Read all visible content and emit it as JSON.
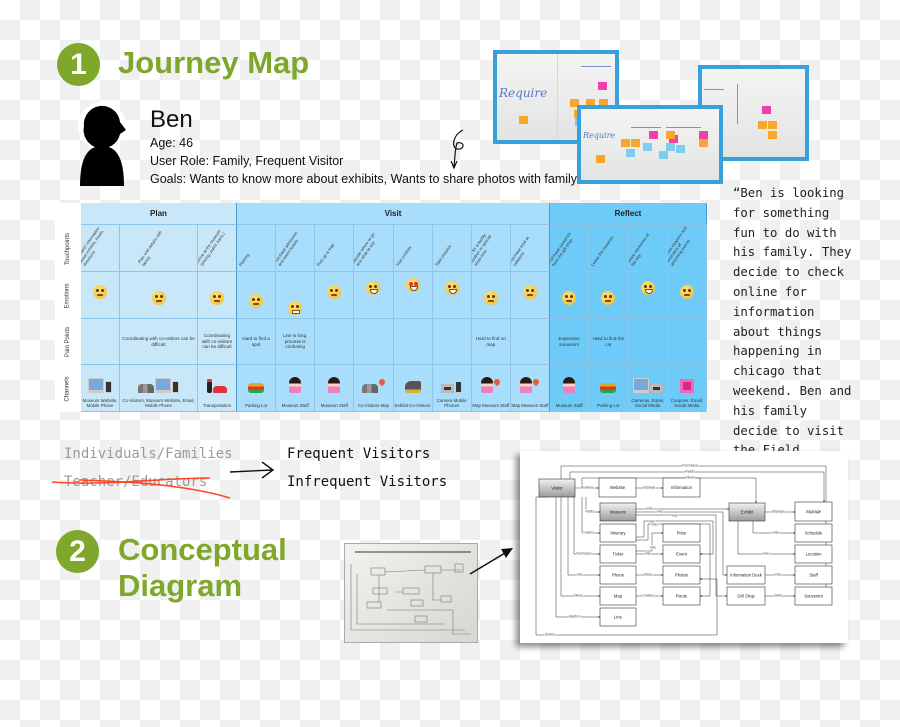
{
  "section1": {
    "number": "1",
    "title": "Journey Map"
  },
  "section2": {
    "number": "2",
    "title_line1": "Conceptual",
    "title_line2": "Diagram"
  },
  "persona": {
    "name": "Ben",
    "age": "Age: 46",
    "role": "User Role: Family, Frequent Visitor",
    "goals": "Goals: Wants to know more about exhibits, Wants to share photos with family"
  },
  "photos": {
    "whiteboard_text": "Require"
  },
  "journey_map": {
    "row_labels": [
      "Touchpoints",
      "Emotions",
      "Pain Points",
      "Channels"
    ],
    "phases": [
      {
        "name": "Plan",
        "columns": 3,
        "color": "#c8e8f9"
      },
      {
        "name": "Visit",
        "columns": 8,
        "color": "#a8defc"
      },
      {
        "name": "Reflect",
        "columns": 4,
        "color": "#6ecbf8"
      }
    ],
    "columns": [
      {
        "touchpoint": "Research information about exhibits, hours, directions",
        "emotion": "relieved",
        "mood": 4,
        "pain": "",
        "channel": "Museum Website, Mobile Phone",
        "icons": [
          "computer-icon",
          "mobile-phone-icon"
        ]
      },
      {
        "touchpoint": "Plan visit details with family",
        "emotion": "flushed",
        "mood": 3,
        "pain": "Coordinating with co-visitors can be difficult",
        "channel": "Co-Visitors, Museum Website, Email, Mobile Phone",
        "icons": [
          "people-icon",
          "computer-icon",
          "mobile-phone-icon"
        ]
      },
      {
        "touchpoint": "Arrive at the museum (driving, public trans.)",
        "emotion": "flushed",
        "mood": 3,
        "pain": "Coordinating with co-visitors can be difficult",
        "channel": "Transportation",
        "icons": [
          "traffic-light-icon",
          "car-icon"
        ]
      },
      {
        "touchpoint": "Parking",
        "emotion": "unamused",
        "mood": 2.5,
        "pain": "Hard to find a spot",
        "channel": "Parking Lot",
        "icons": [
          "cars-icon"
        ]
      },
      {
        "touchpoint": "Purchase admission and event tickets",
        "emotion": "persevering",
        "mood": 1.5,
        "pain": "Line is long, process is confusing",
        "channel": "Museum Staff",
        "icons": [
          "staff-icon"
        ]
      },
      {
        "touchpoint": "Pick up a map",
        "emotion": "relieved",
        "mood": 4,
        "pain": "",
        "channel": "Museum Staff",
        "icons": [
          "staff-icon"
        ]
      },
      {
        "touchpoint": "Decide where to go and what to see",
        "emotion": "grinning",
        "mood": 4.5,
        "pain": "",
        "channel": "Co-Visitors Map",
        "icons": [
          "people-icon",
          "map-pin-icon"
        ]
      },
      {
        "touchpoint": "Visit exhibits",
        "emotion": "heart-eyes",
        "mood": 5,
        "pain": "",
        "channel": "Exhibit Co-Visitors",
        "icons": [
          "dinosaur-icon"
        ]
      },
      {
        "touchpoint": "Take pictures",
        "emotion": "grinning",
        "mood": 4.5,
        "pain": "",
        "channel": "Camera Mobile Phones",
        "icons": [
          "camera-icon",
          "mobile-phone-icon"
        ]
      },
      {
        "touchpoint": "Look for a facility location or special show time",
        "emotion": "flushed",
        "mood": 3,
        "pain": "Hard to find on map",
        "channel": "Map Museum Staff",
        "icons": [
          "staff-icon",
          "map-pin-icon"
        ]
      },
      {
        "touchpoint": "Purchase food at cafeteria",
        "emotion": "relieved",
        "mood": 4,
        "pain": "",
        "channel": "Map Museum Staff",
        "icons": [
          "staff-icon",
          "map-pin-icon"
        ]
      },
      {
        "touchpoint": "Purchase souvenirs from the gift shop",
        "emotion": "flushed",
        "mood": 3,
        "pain": "Expensive souvenirs",
        "channel": "Museum Staff",
        "icons": [
          "staff-icon"
        ]
      },
      {
        "touchpoint": "Leave the museum",
        "emotion": "flushed",
        "mood": 3,
        "pain": "Hard to find the car",
        "channel": "Parking Lot",
        "icons": [
          "cars-icon"
        ]
      },
      {
        "touchpoint": "Share memories of the day",
        "emotion": "grinning",
        "mood": 4.5,
        "pain": "",
        "channel": "Cameras, Email, Social Media",
        "icons": [
          "computer-icon",
          "camera-icon"
        ]
      },
      {
        "touchpoint": "Receive coupons and reminders of upcoming events",
        "emotion": "relieved",
        "mood": 4,
        "pain": "",
        "channel": "Coupons, Email, Social Media",
        "icons": [
          "coupon-icon"
        ]
      }
    ]
  },
  "quote": "“Ben is looking for something fun to do with his family. They decide to check online for information about things happening in chicago that weekend. Ben and his family decide to visit the Field Museum. ”",
  "segments": {
    "kept": "Individuals/Families",
    "crossed_out": "Teacher/Educators",
    "result1": "Frequent Visitors",
    "result2": "Infrequent Visitors",
    "strike_color": "#ff4422"
  },
  "diagram": {
    "nodes": {
      "visitor": "Visitor",
      "website": "Website",
      "information": "Information",
      "museum": "Museum",
      "exhibit": "Exhibit",
      "signage": "Signage",
      "itinerary": "Itinerary",
      "prize": "Prize",
      "schedule": "Schedule",
      "ticket": "Ticket",
      "event": "Event",
      "location": "Location",
      "phone": "Phone",
      "photos": "Photos",
      "info_desk": "Information Desk",
      "staff": "Staff",
      "map": "Map",
      "route": "Route",
      "gift_shop": "Gift Shop",
      "souvenirs": "Souvenirs",
      "line": "Line"
    },
    "edges": {
      "purchases_top": "Purchases",
      "reads": "Reads",
      "views_top": "Views",
      "browses": "Browses",
      "displays1": "Displays",
      "visits": "Visits",
      "creates1": "Creates",
      "purchases": "Purchases",
      "has_phone": "Has",
      "views": "Views",
      "waits_in": "Waits in",
      "shares": "Shares",
      "has_m1": "Has",
      "has_m2": "Has",
      "has_m3": "Has",
      "has_it1": "Has",
      "has_it2": "Has",
      "has_prize": "Has",
      "has_event": "Has",
      "takes": "Takes",
      "creates2": "Creates",
      "displays2": "Displays",
      "has_sched": "Has",
      "has_loc": "Has",
      "has_staff": "Has",
      "sells": "Sells"
    }
  }
}
